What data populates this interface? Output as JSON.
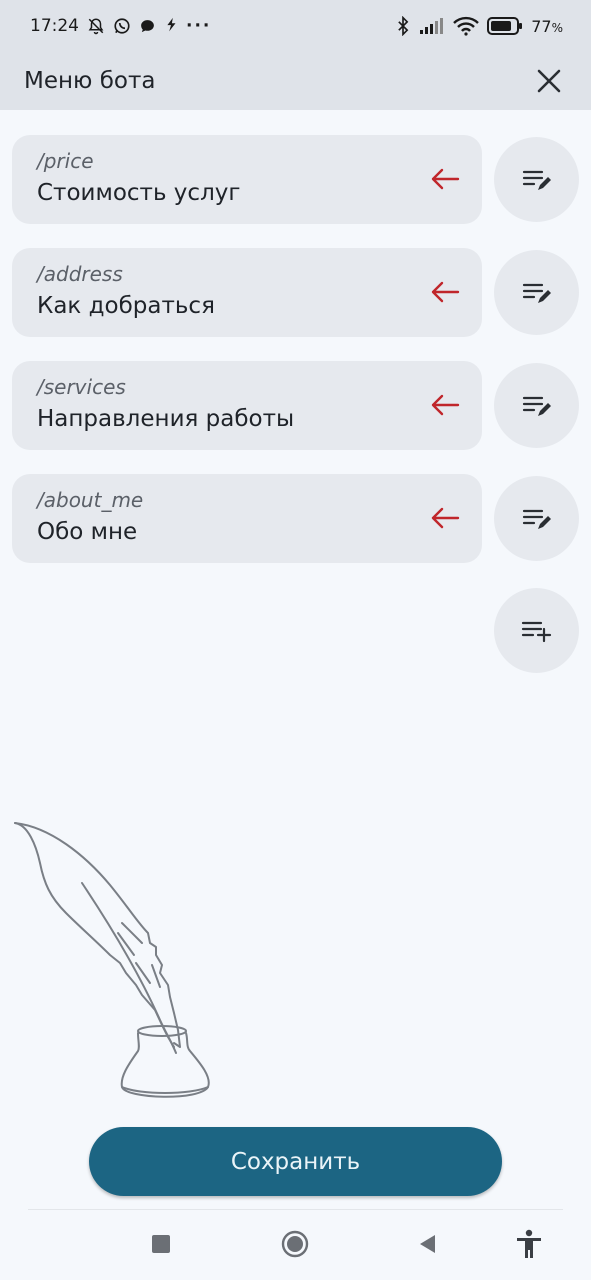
{
  "status_bar": {
    "time": "17:24",
    "battery_percent": "77",
    "battery_unit": "%",
    "more": "···",
    "icons": [
      "mute-bell-icon",
      "whatsapp-icon",
      "chat-icon",
      "bolt-icon",
      "bluetooth-icon",
      "signal-icon",
      "wifi-icon",
      "battery-icon"
    ]
  },
  "header": {
    "title": "Меню бота",
    "close_icon": "close-icon"
  },
  "commands": [
    {
      "name": "/price",
      "description": "Стоимость услуг"
    },
    {
      "name": "/address",
      "description": "Как добраться"
    },
    {
      "name": "/services",
      "description": "Направления работы"
    },
    {
      "name": "/about_me",
      "description": "Обо мне"
    }
  ],
  "command_icons": {
    "arrow": "arrow-left-icon",
    "edit": "list-edit-icon",
    "add": "list-add-icon"
  },
  "colors": {
    "accent": "#1c6583",
    "arrow": "#c0262b",
    "card": "#e6e9ee",
    "header": "#dfe3e9",
    "background": "#f5f8fc"
  },
  "illustration": "quill-inkwell-illustration",
  "save_button": {
    "label": "Сохранить"
  },
  "nav_bar": {
    "icons": [
      "recents-square-icon",
      "home-circle-icon",
      "back-triangle-icon",
      "accessibility-icon"
    ]
  }
}
